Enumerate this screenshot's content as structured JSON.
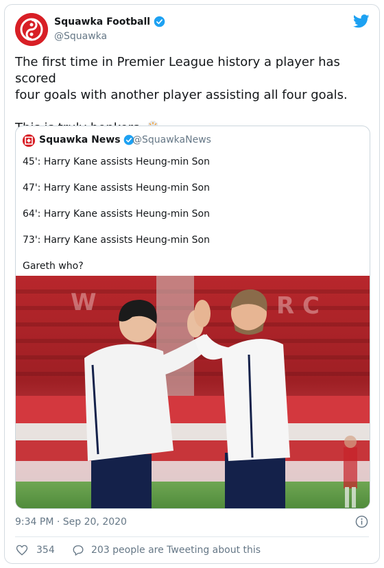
{
  "author": {
    "name": "Squawka Football",
    "handle": "@Squawka"
  },
  "tweet": {
    "line1": "The first time in Premier League history a player has scored",
    "line2": "four goals with another player assisting all four goals.",
    "line3": "This is truly bonkers."
  },
  "quoted": {
    "name": "Squawka News",
    "handle": "@SquawkaNews",
    "lines": [
      "45': Harry Kane assists Heung-min Son",
      "47': Harry Kane assists Heung-min Son",
      "64': Harry Kane assists Heung-min Son",
      "73': Harry Kane assists Heung-min Son",
      "Gareth who?"
    ]
  },
  "meta": {
    "timestamp": "9:34 PM · Sep 20, 2020",
    "likes": "354",
    "replies": "203 people are Tweeting about this"
  },
  "icons": {
    "verified": "verified-icon",
    "twitter": "twitter-bird-icon",
    "emoji": "exploding-head-emoji",
    "info": "info-icon",
    "heart": "heart-icon",
    "comment": "comment-icon"
  },
  "colors": {
    "brand_red": "#d81f26",
    "twitter_blue": "#1da1f2",
    "secondary_text": "#657786"
  }
}
